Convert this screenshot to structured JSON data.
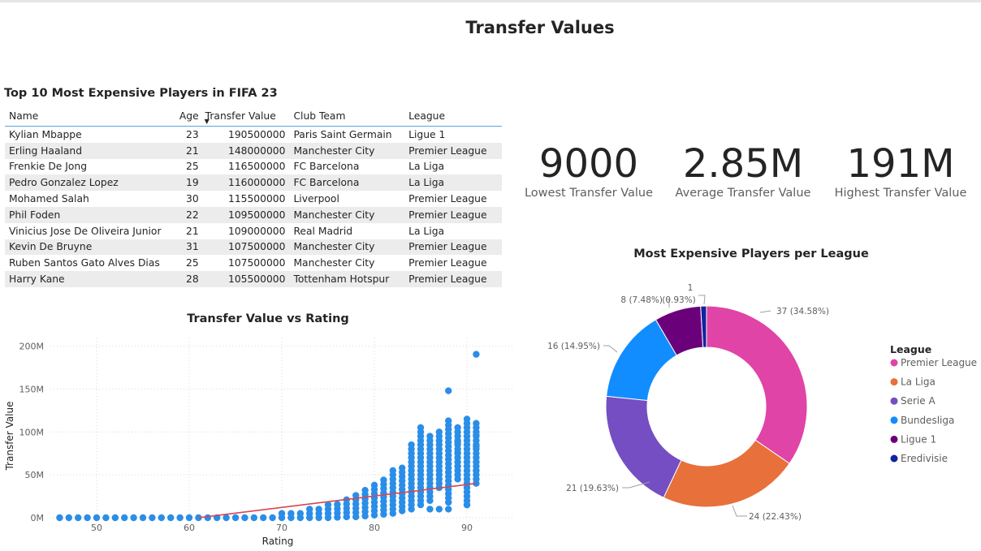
{
  "page_title": "Transfer Values",
  "table": {
    "title": "Top 10 Most Expensive Players in FIFA 23",
    "columns": [
      "Name",
      "Age",
      "Transfer Value",
      "Club Team",
      "League"
    ],
    "rows": [
      [
        "Kylian Mbappe",
        "23",
        "190500000",
        "Paris Saint Germain",
        "Ligue 1"
      ],
      [
        "Erling Haaland",
        "21",
        "148000000",
        "Manchester City",
        "Premier League"
      ],
      [
        "Frenkie De Jong",
        "25",
        "116500000",
        "FC Barcelona",
        "La Liga"
      ],
      [
        "Pedro Gonzalez Lopez",
        "19",
        "116000000",
        "FC Barcelona",
        "La Liga"
      ],
      [
        "Mohamed Salah",
        "30",
        "115500000",
        "Liverpool",
        "Premier League"
      ],
      [
        "Phil Foden",
        "22",
        "109500000",
        "Manchester City",
        "Premier League"
      ],
      [
        "Vinicius Jose De Oliveira Junior",
        "21",
        "109000000",
        "Real Madrid",
        "La Liga"
      ],
      [
        "Kevin De Bruyne",
        "31",
        "107500000",
        "Manchester City",
        "Premier League"
      ],
      [
        "Ruben Santos Gato Alves Dias",
        "25",
        "107500000",
        "Manchester City",
        "Premier League"
      ],
      [
        "Harry Kane",
        "28",
        "105500000",
        "Tottenham Hotspur",
        "Premier League"
      ]
    ]
  },
  "kpis": [
    {
      "value": "9000",
      "label": "Lowest Transfer Value"
    },
    {
      "value": "2.85M",
      "label": "Average Transfer Value"
    },
    {
      "value": "191M",
      "label": "Highest Transfer Value"
    }
  ],
  "colors": {
    "scatter_point": "#2a8ee8",
    "trend_line": "#d64550",
    "premier_league": "#e044a7",
    "la_liga": "#e8703a",
    "serie_a": "#744ec2",
    "bundesliga": "#118dff",
    "ligue_1": "#6b007b",
    "eredivisie": "#12239e"
  },
  "chart_data": [
    {
      "type": "scatter",
      "title": "Transfer Value vs Rating",
      "xlabel": "Rating",
      "ylabel": "Transfer Value",
      "xlim": [
        45,
        95
      ],
      "ylim": [
        0,
        210000000
      ],
      "x_ticks": [
        50,
        60,
        70,
        80,
        90
      ],
      "y_ticks": [
        {
          "value": 0,
          "label": "0M"
        },
        {
          "value": 50000000,
          "label": "50M"
        },
        {
          "value": 100000000,
          "label": "100M"
        },
        {
          "value": 150000000,
          "label": "150M"
        },
        {
          "value": 200000000,
          "label": "200M"
        }
      ],
      "grid": true,
      "trend_line": {
        "x": [
          61,
          91
        ],
        "y": [
          0,
          40000000
        ]
      },
      "columns": [
        {
          "x": 46,
          "min": 0,
          "max": 0
        },
        {
          "x": 47,
          "min": 0,
          "max": 0
        },
        {
          "x": 48,
          "min": 0,
          "max": 0
        },
        {
          "x": 49,
          "min": 0,
          "max": 0
        },
        {
          "x": 50,
          "min": 0,
          "max": 0
        },
        {
          "x": 51,
          "min": 0,
          "max": 0
        },
        {
          "x": 52,
          "min": 0,
          "max": 0
        },
        {
          "x": 53,
          "min": 0,
          "max": 0
        },
        {
          "x": 54,
          "min": 0,
          "max": 0
        },
        {
          "x": 55,
          "min": 0,
          "max": 0
        },
        {
          "x": 56,
          "min": 0,
          "max": 0
        },
        {
          "x": 57,
          "min": 0,
          "max": 0
        },
        {
          "x": 58,
          "min": 0,
          "max": 0
        },
        {
          "x": 59,
          "min": 0,
          "max": 0
        },
        {
          "x": 60,
          "min": 0,
          "max": 0
        },
        {
          "x": 61,
          "min": 0,
          "max": 0
        },
        {
          "x": 62,
          "min": 0,
          "max": 0
        },
        {
          "x": 63,
          "min": 0,
          "max": 500000
        },
        {
          "x": 64,
          "min": 0,
          "max": 1000000
        },
        {
          "x": 65,
          "min": 0,
          "max": 1500000
        },
        {
          "x": 66,
          "min": 0,
          "max": 2000000
        },
        {
          "x": 67,
          "min": 0,
          "max": 2500000
        },
        {
          "x": 68,
          "min": 0,
          "max": 3000000
        },
        {
          "x": 69,
          "min": 0,
          "max": 4000000
        },
        {
          "x": 70,
          "min": 0,
          "max": 5000000
        },
        {
          "x": 71,
          "min": 0,
          "max": 6500000
        },
        {
          "x": 72,
          "min": 0,
          "max": 8000000
        },
        {
          "x": 73,
          "min": 0,
          "max": 10000000
        },
        {
          "x": 74,
          "min": 0,
          "max": 12000000
        },
        {
          "x": 75,
          "min": 0,
          "max": 16000000
        },
        {
          "x": 76,
          "min": 500000,
          "max": 20000000
        },
        {
          "x": 77,
          "min": 1000000,
          "max": 24000000
        },
        {
          "x": 78,
          "min": 1000000,
          "max": 28000000
        },
        {
          "x": 79,
          "min": 2000000,
          "max": 32000000
        },
        {
          "x": 80,
          "min": 3000000,
          "max": 38000000
        },
        {
          "x": 81,
          "min": 4000000,
          "max": 45000000
        },
        {
          "x": 82,
          "min": 5000000,
          "max": 55000000
        },
        {
          "x": 83,
          "min": 8000000,
          "max": 60000000
        },
        {
          "x": 84,
          "min": 10000000,
          "max": 85000000
        },
        {
          "x": 85,
          "min": 15000000,
          "max": 105000000
        },
        {
          "x": 86,
          "min": 20000000,
          "max": 95000000
        },
        {
          "x": 87,
          "min": 35000000,
          "max": 100000000
        },
        {
          "x": 88,
          "min": 18000000,
          "max": 115000000
        },
        {
          "x": 89,
          "min": 45000000,
          "max": 105000000
        },
        {
          "x": 90,
          "min": 15000000,
          "max": 116000000
        },
        {
          "x": 91,
          "min": 40000000,
          "max": 110000000
        }
      ],
      "points": [
        {
          "x": 91,
          "y": 190500000
        },
        {
          "x": 88,
          "y": 148000000
        },
        {
          "x": 91,
          "y": 65000000
        },
        {
          "x": 91,
          "y": 55000000
        },
        {
          "x": 91,
          "y": 83000000
        },
        {
          "x": 91,
          "y": 96000000
        },
        {
          "x": 89,
          "y": 76000000
        },
        {
          "x": 89,
          "y": 88000000
        },
        {
          "x": 90,
          "y": 15000000
        },
        {
          "x": 86,
          "y": 10000000
        },
        {
          "x": 88,
          "y": 10000000
        },
        {
          "x": 87,
          "y": 10000000
        }
      ]
    },
    {
      "type": "pie",
      "title": "Most Expensive Players per League",
      "legend_title": "League",
      "legend_position": "right",
      "categories": [
        "Premier League",
        "La Liga",
        "Serie A",
        "Bundesliga",
        "Ligue 1",
        "Eredivisie"
      ],
      "values": [
        37,
        24,
        21,
        16,
        8,
        1
      ],
      "labels": [
        "37 (34.58%)",
        "24 (22.43%)",
        "21 (19.63%)",
        "16 (14.95%)",
        "8 (7.48%)",
        "1\n(0.93%)"
      ],
      "label_lines": [
        "37 (34.58%)",
        "24 (22.43%)",
        "21 (19.63%)",
        "16 (14.95%)",
        "8 (7.48%)",
        "1",
        "(0.93%)"
      ]
    }
  ]
}
